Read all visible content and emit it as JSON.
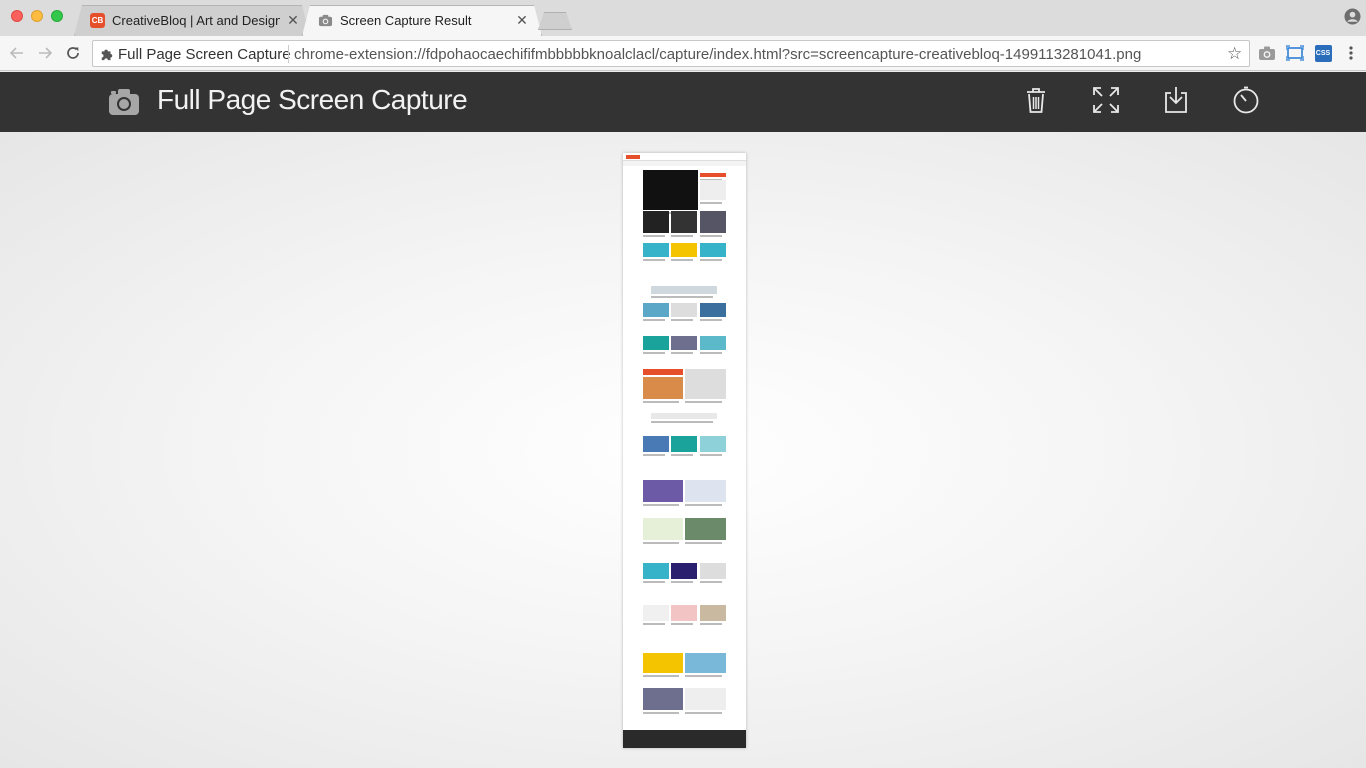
{
  "browser": {
    "tabs": [
      {
        "title": "CreativeBloq | Art and Design",
        "favicon_text": "CB",
        "favicon_color": "#e5502b",
        "active": false
      },
      {
        "title": "Screen Capture Result",
        "active": true
      }
    ],
    "omnibox": {
      "site_label": "Full Page Screen Capture",
      "url": "chrome-extension://fdpohaocaechififmbbbbbknoalclacl/capture/index.html?src=screencapture-creativebloq-1499113281041.png"
    },
    "icons": {
      "back": "back-arrow-icon",
      "forward": "forward-arrow-icon",
      "reload": "reload-icon",
      "bookmark": "star-icon",
      "ext1": "camera-icon",
      "ext2": "screen-icon",
      "ext3": "css-icon",
      "menu": "kebab-menu-icon"
    },
    "ext3_text": "CSS"
  },
  "app": {
    "title": "Full Page Screen Capture",
    "header_bg": "#333333",
    "actions": [
      {
        "name": "delete",
        "icon": "trash-icon"
      },
      {
        "name": "fullscreen",
        "icon": "expand-icon"
      },
      {
        "name": "download",
        "icon": "download-icon"
      },
      {
        "name": "timer",
        "icon": "stopwatch-icon"
      }
    ]
  },
  "capture": {
    "source_site": "CreativeBloq",
    "accent": "#e5502b"
  }
}
